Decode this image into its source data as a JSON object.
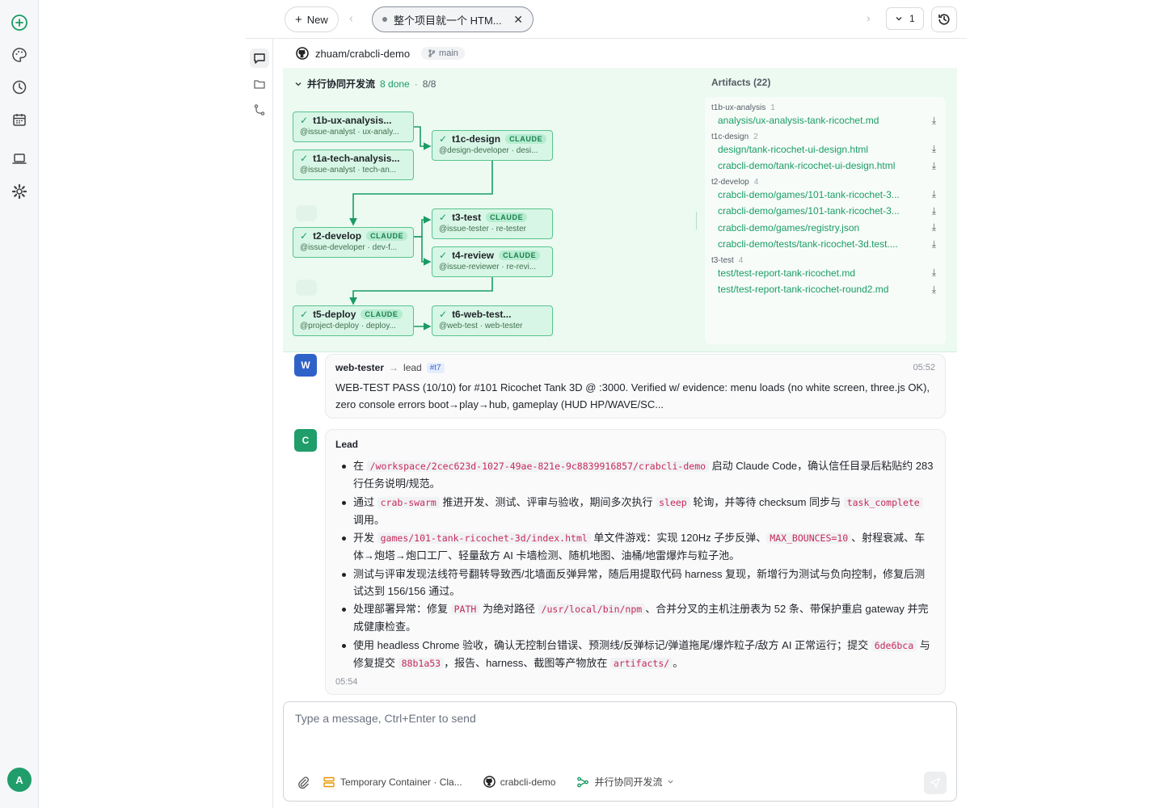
{
  "topbar": {
    "new_label": "New",
    "tab_title": "整个项目就一个 HTM...",
    "count": "1"
  },
  "repo": {
    "name": "zhuam/crabcli-demo",
    "branch": "main"
  },
  "workflow": {
    "title": "并行协同开发流",
    "done": "8 done",
    "sep": "·",
    "progress": "8/8",
    "badge": "CLAUDE",
    "nodes": [
      {
        "name": "t1b-ux-analysis...",
        "sub": "@issue-analyst · ux-analy...",
        "claude": false
      },
      {
        "name": "t1a-tech-analysis...",
        "sub": "@issue-analyst · tech-an...",
        "claude": false
      },
      {
        "name": "t1c-design",
        "sub": "@design-developer · desi...",
        "claude": true
      },
      {
        "name": "t2-develop",
        "sub": "@issue-developer · dev-f...",
        "claude": true
      },
      {
        "name": "t3-test",
        "sub": "@issue-tester · re-tester",
        "claude": true
      },
      {
        "name": "t4-review",
        "sub": "@issue-reviewer · re-revi...",
        "claude": true
      },
      {
        "name": "t5-deploy",
        "sub": "@project-deploy · deploy...",
        "claude": true
      },
      {
        "name": "t6-web-test...",
        "sub": "@web-test · web-tester",
        "claude": false
      }
    ]
  },
  "artifacts": {
    "title": "Artifacts (22)",
    "groups": [
      {
        "name": "t1b-ux-analysis",
        "count": "1",
        "files": [
          "analysis/ux-analysis-tank-ricochet.md"
        ]
      },
      {
        "name": "t1c-design",
        "count": "2",
        "files": [
          "design/tank-ricochet-ui-design.html",
          "crabcli-demo/tank-ricochet-ui-design.html"
        ]
      },
      {
        "name": "t2-develop",
        "count": "4",
        "files": [
          "crabcli-demo/games/101-tank-ricochet-3...",
          "crabcli-demo/games/101-tank-ricochet-3...",
          "crabcli-demo/games/registry.json",
          "crabcli-demo/tests/tank-ricochet-3d.test...."
        ]
      },
      {
        "name": "t3-test",
        "count": "4",
        "files": [
          "test/test-report-tank-ricochet.md",
          "test/test-report-tank-ricochet-round2.md"
        ]
      }
    ]
  },
  "messages": [
    {
      "avatar": "W",
      "sender": "web-tester",
      "arrow": "→",
      "to": "lead",
      "tag": "#t7",
      "time": "05:52",
      "body": "WEB-TEST PASS (10/10) for #101 Ricochet Tank 3D @ :3000. Verified w/ evidence: menu loads (no white screen, three.js OK), zero console errors boot→play→hub, gameplay (HUD HP/WAVE/SC..."
    },
    {
      "avatar": "C",
      "sender": "Lead",
      "time": "05:54",
      "bullets": [
        [
          "在 ",
          {
            "code": "/workspace/2cec623d-1027-49ae-821e-9c8839916857/crabcli-demo"
          },
          " 启动 Claude Code，确认信任目录后粘贴约 283 行任务说明/规范。"
        ],
        [
          "通过 ",
          {
            "code": "crab-swarm"
          },
          " 推进开发、测试、评审与验收，期间多次执行 ",
          {
            "code": "sleep"
          },
          " 轮询，并等待 checksum 同步与 ",
          {
            "code": "task_complete"
          },
          " 调用。"
        ],
        [
          "开发 ",
          {
            "code": "games/101-tank-ricochet-3d/index.html"
          },
          " 单文件游戏：实现 120Hz 子步反弹、",
          {
            "code": "MAX_BOUNCES=10"
          },
          "、射程衰减、车体→炮塔→炮口工厂、轻量敌方 AI 卡墙检测、随机地图、油桶/地雷爆炸与粒子池。"
        ],
        [
          "测试与评审发现法线符号翻转导致西/北墙面反弹异常，随后用提取代码 harness 复现，新增行为测试与负向控制，修复后测试达到 156/156 通过。"
        ],
        [
          "处理部署异常：修复 ",
          {
            "code": "PATH"
          },
          " 为绝对路径 ",
          {
            "code": "/usr/local/bin/npm"
          },
          "、合并分叉的主机注册表为 52 条、带保护重启 gateway 并完成健康检查。"
        ],
        [
          "使用 headless Chrome 验收，确认无控制台错误、预测线/反弹标记/弹道拖尾/爆炸粒子/敌方 AI 正常运行；提交 ",
          {
            "code": "6de6bca"
          },
          " 与修复提交 ",
          {
            "code": "88b1a53"
          },
          "，报告、harness、截图等产物放在 ",
          {
            "code": "artifacts/"
          },
          "。"
        ]
      ]
    }
  ],
  "composer": {
    "placeholder": "Type a message, Ctrl+Enter to send",
    "container": "Temporary Container · Cla...",
    "repo": "crabcli-demo",
    "workflow": "并行协同开发流"
  },
  "user": {
    "initial": "A"
  },
  "colors": {
    "accent": "#1a9c64",
    "node_bg": "#d8f6e6",
    "node_border": "#58c48e",
    "code": "#c62a5a"
  }
}
